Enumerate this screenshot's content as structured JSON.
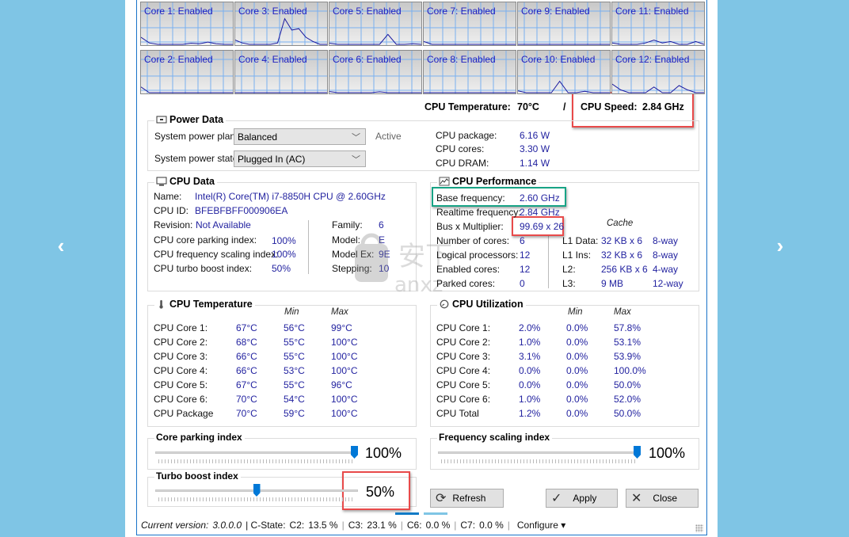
{
  "nav": {
    "prev": "‹",
    "next": "›"
  },
  "cores": [
    {
      "label": "Core 1: Enabled",
      "points": [
        0.25,
        0.05,
        0,
        0,
        0,
        0,
        0.04,
        0.02,
        0.08,
        0.02,
        0,
        0
      ]
    },
    {
      "label": "Core 3: Enabled",
      "points": [
        0.15,
        0.05,
        0,
        0,
        0,
        0,
        0.05,
        0.9,
        0.5,
        0.55,
        0.25,
        0.1,
        0,
        0
      ]
    },
    {
      "label": "Core 5: Enabled",
      "points": [
        0.04,
        0,
        0,
        0,
        0,
        0,
        0,
        0.35,
        0,
        0,
        0.02,
        0
      ]
    },
    {
      "label": "Core 7: Enabled",
      "points": [
        0.1,
        0,
        0,
        0,
        0,
        0,
        0,
        0,
        0,
        0,
        0,
        0
      ]
    },
    {
      "label": "Core 9: Enabled",
      "points": [
        0,
        0,
        0,
        0,
        0,
        0,
        0,
        0,
        0,
        0,
        0,
        0
      ]
    },
    {
      "label": "Core 11: Enabled",
      "points": [
        0.05,
        0,
        0,
        0,
        0.05,
        0.15,
        0.05,
        0.1,
        0,
        0,
        0.1,
        0
      ]
    },
    {
      "label": "Core 2: Enabled",
      "points": [
        0.2,
        0,
        0,
        0,
        0,
        0,
        0,
        0,
        0,
        0,
        0,
        0
      ]
    },
    {
      "label": "Core 4: Enabled",
      "points": [
        0,
        0,
        0,
        0,
        0,
        0,
        0,
        0,
        0,
        0,
        0,
        0
      ]
    },
    {
      "label": "Core 6: Enabled",
      "points": [
        0.04,
        0,
        0,
        0,
        0,
        0,
        0.03,
        0,
        0,
        0,
        0,
        0
      ]
    },
    {
      "label": "Core 8: Enabled",
      "points": [
        0,
        0,
        0,
        0,
        0,
        0,
        0,
        0,
        0,
        0,
        0,
        0
      ]
    },
    {
      "label": "Core 10: Enabled",
      "points": [
        0.06,
        0,
        0,
        0,
        0,
        0.4,
        0,
        0,
        0.05,
        0,
        0,
        0
      ]
    },
    {
      "label": "Core 12: Enabled",
      "points": [
        0.3,
        0.1,
        0,
        0,
        0,
        0.2,
        0,
        0,
        0.25,
        0.1,
        0,
        0
      ]
    }
  ],
  "status": {
    "temp_label": "CPU Temperature:",
    "temp_value": "70°C",
    "divider": "/",
    "speed_label": "CPU Speed:",
    "speed_value": "2.84 GHz"
  },
  "power": {
    "title": "Power Data",
    "plan_label": "System power plan:",
    "plan_value": "Balanced",
    "plan_status": "Active",
    "state_label": "System power state:",
    "state_value": "Plugged In (AC)",
    "rows": [
      {
        "label": "CPU package:",
        "value": "6.16 W"
      },
      {
        "label": "CPU cores:",
        "value": "3.30 W"
      },
      {
        "label": "CPU DRAM:",
        "value": "1.14 W"
      }
    ]
  },
  "cpu_data": {
    "title": "CPU Data",
    "name_label": "Name:",
    "name_value": "Intel(R) Core(TM) i7-8850H CPU @ 2.60GHz",
    "id_label": "CPU ID:",
    "id_value": "BFEBFBFF000906EA",
    "rev_label": "Revision:",
    "rev_value": "Not Available",
    "left": [
      {
        "label": "CPU core parking index:",
        "value": "100%"
      },
      {
        "label": "CPU frequency scaling index:",
        "value": "100%"
      },
      {
        "label": "CPU turbo boost index:",
        "value": "50%"
      }
    ],
    "right": [
      {
        "label": "Family:",
        "value": "6"
      },
      {
        "label": "Model:",
        "value": "E"
      },
      {
        "label": "Model Ex:",
        "value": "9E"
      },
      {
        "label": "Stepping:",
        "value": "10"
      }
    ]
  },
  "perf": {
    "title": "CPU Performance",
    "rows": [
      {
        "label": "Base frequency:",
        "value": "2.60 GHz"
      },
      {
        "label": "Realtime frequency:",
        "value": "2.84 GHz"
      },
      {
        "label": "Bus x Multiplier:",
        "value": "99.69 x 26"
      },
      {
        "label": "Number of cores:",
        "value": "6"
      },
      {
        "label": "Logical processors:",
        "value": "12"
      },
      {
        "label": "Enabled cores:",
        "value": "12"
      },
      {
        "label": "Parked cores:",
        "value": "0"
      }
    ],
    "cache_header": "Cache",
    "cache": [
      {
        "label": "L1 Data:",
        "size": "32 KB x 6",
        "way": "8-way"
      },
      {
        "label": "L1 Ins:",
        "size": "32 KB x 6",
        "way": "8-way"
      },
      {
        "label": "L2:",
        "size": "256 KB x 6",
        "way": "4-way"
      },
      {
        "label": "L3:",
        "size": "9 MB",
        "way": "12-way"
      }
    ]
  },
  "temperature": {
    "title": "CPU Temperature",
    "min_header": "Min",
    "max_header": "Max",
    "rows": [
      {
        "label": "CPU Core 1:",
        "cur": "67°C",
        "min": "56°C",
        "max": "99°C"
      },
      {
        "label": "CPU Core 2:",
        "cur": "68°C",
        "min": "55°C",
        "max": "100°C"
      },
      {
        "label": "CPU Core 3:",
        "cur": "66°C",
        "min": "55°C",
        "max": "100°C"
      },
      {
        "label": "CPU Core 4:",
        "cur": "66°C",
        "min": "53°C",
        "max": "100°C"
      },
      {
        "label": "CPU Core 5:",
        "cur": "67°C",
        "min": "55°C",
        "max": "96°C"
      },
      {
        "label": "CPU Core 6:",
        "cur": "70°C",
        "min": "54°C",
        "max": "100°C"
      },
      {
        "label": "CPU Package",
        "cur": "70°C",
        "min": "59°C",
        "max": "100°C"
      }
    ]
  },
  "utilization": {
    "title": "CPU Utilization",
    "min_header": "Min",
    "max_header": "Max",
    "rows": [
      {
        "label": "CPU Core 1:",
        "cur": "2.0%",
        "min": "0.0%",
        "max": "57.8%"
      },
      {
        "label": "CPU Core 2:",
        "cur": "1.0%",
        "min": "0.0%",
        "max": "53.1%"
      },
      {
        "label": "CPU Core 3:",
        "cur": "3.1%",
        "min": "0.0%",
        "max": "53.9%"
      },
      {
        "label": "CPU Core 4:",
        "cur": "0.0%",
        "min": "0.0%",
        "max": "100.0%"
      },
      {
        "label": "CPU Core 5:",
        "cur": "0.0%",
        "min": "0.0%",
        "max": "50.0%"
      },
      {
        "label": "CPU Core 6:",
        "cur": "1.0%",
        "min": "0.0%",
        "max": "52.0%"
      },
      {
        "label": "CPU Total",
        "cur": "1.2%",
        "min": "0.0%",
        "max": "50.0%"
      }
    ]
  },
  "sliders": {
    "parking": {
      "title": "Core parking index",
      "value_text": "100%",
      "value": 1.0
    },
    "scaling": {
      "title": "Frequency scaling index",
      "value_text": "100%",
      "value": 1.0
    },
    "turbo": {
      "title": "Turbo boost index",
      "value_text": "50%",
      "value": 0.5
    }
  },
  "buttons": {
    "refresh": "Refresh",
    "apply": "Apply",
    "close": "Close"
  },
  "statusbar": {
    "version_label": "Current version:",
    "version": "3.0.0.0",
    "cstate_label": "| C-State:",
    "c2_label": "C2:",
    "c2": "13.5 %",
    "c3_label": "C3:",
    "c3": "23.1 %",
    "c6_label": "C6:",
    "c6": "0.0 %",
    "c7_label": "C7:",
    "c7": "0.0 %",
    "configure": "Configure ▾"
  },
  "colors": {
    "accent": "#0078d7",
    "value_text": "#2323a0",
    "highlight_red": "#e84a4a",
    "highlight_green": "#17a385",
    "background": "#7fc5e5"
  }
}
